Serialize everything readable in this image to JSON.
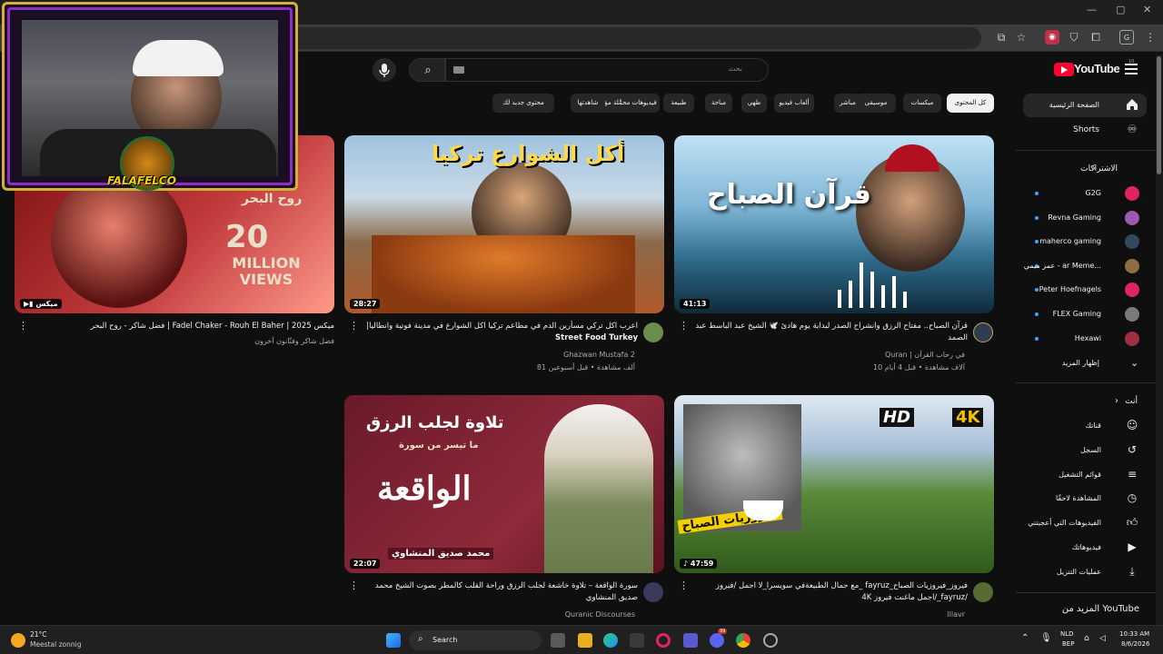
{
  "header": {
    "logo_text": "YouTube",
    "logo_sup": "10",
    "search_placeholder": "بحث"
  },
  "chips": [
    {
      "label": "كل المحتوى",
      "active": true
    },
    {
      "label": "ميكسات"
    },
    {
      "label": "موسيقى"
    },
    {
      "label": "مباشر"
    },
    {
      "label": "ألعاب فيديو"
    },
    {
      "label": "طهي"
    },
    {
      "label": "مباحة"
    },
    {
      "label": "طبيعة"
    },
    {
      "label": "فيديوهات محمَّلة مؤخرًا"
    },
    {
      "label": "شاهدتها"
    },
    {
      "label": "محتوى جديد لك"
    }
  ],
  "sidebar": {
    "home": "الصفحة الرئيسية",
    "shorts": "Shorts",
    "subs_heading": "الاشتراكات",
    "subscriptions": [
      {
        "name": "G2G",
        "color": "#e0245e"
      },
      {
        "name": "Revna Gaming",
        "color": "#9b59b6"
      },
      {
        "name": "maherco gaming",
        "color": "#34495e"
      },
      {
        "name": "عمر ميمي - ar Meme...",
        "color": "#8e6e3e"
      },
      {
        "name": "Peter Hoefnagels",
        "color": "#e0245e"
      },
      {
        "name": "FLEX Gaming",
        "color": "#7a7a7a"
      },
      {
        "name": "Hexawi",
        "color": "#a03040"
      }
    ],
    "show_more": "إظهار المزيد",
    "you_heading": "أنت",
    "you_items": [
      "قناتك",
      "السجل",
      "قوائم التشغيل",
      "المشاهدة لاحقًا",
      "الفيديوهات التي أعجبتني",
      "فيديوهاتك",
      "عمليات التنزيل"
    ],
    "more_from": "المزيد من YouTube"
  },
  "videos": [
    {
      "title": "ميكس Fadel Chaker - Rouh El Baher | 2025 | فضل شاكر - روح البحر",
      "channel": "فضل شاكر وفنّانون آخرون",
      "stats": "",
      "duration": "ميكس",
      "thumb_text": "20 MILLION VIEWS",
      "thumb_sub": "روح البحر",
      "avatar_color": ""
    },
    {
      "title": "اعرب اكل تركي مسأرين الدم في مطاعم تركيا  اكل الشوارع في مدينة فوتية وانطاليا|",
      "title_en": "Street Food Turkey",
      "channel": "Ghazwan Mustafa 2",
      "stats": "81 ألف مشاهدة • قبل أسبوعين",
      "duration": "28:27",
      "thumb_text": "أكل الشوارع تركيا",
      "avatar_color": "#6b8e4e"
    },
    {
      "title": "قرآن الصباح.. مفتاح الرزق وانشراح الصدر لبداية يوم هادئ 🕊️ الشيخ عبد الباسط عبد الصمد",
      "channel": "Quran | في رحاب القرآن",
      "stats": "10 آلاف مشاهدة • قبل 4 أيام",
      "duration": "41:13",
      "thumb_text": "قرآن الصباح",
      "avatar_color": "#2c3e50"
    },
    {
      "title": "سورة الواقعة – تلاوة خاشعة لجلب الرزق وراحة القلب كالمطر   بصوت الشيخ محمد صديق المنشاوي",
      "channel": "Quranic Discourses",
      "stats": "",
      "duration": "22:07",
      "thumb_text": "تلاوة لجلب الرزق",
      "thumb_sub": "ما تيسر من سورة",
      "thumb_big": "الواقعة",
      "thumb_name": "محمد صديق المنشاوي",
      "avatar_color": "#3a3a5a"
    },
    {
      "title": "فيروز_فيروزيات الصباح_fayruz _مع جمال الطبيعةفي سويسرا_لا اجمل /فيروز /fayruz_/اجمل ماغنت فيروز 4K",
      "channel": "lilavr",
      "stats": "",
      "duration": "47:59",
      "thumb_text": "فيروزيات الصباح",
      "thumb_badge": "HD",
      "thumb_badge2": "4K",
      "avatar_color": "#556b2f"
    }
  ],
  "overlay": {
    "brand": "FALAFELCO"
  },
  "taskbar": {
    "weather_temp": "21°C",
    "weather_desc": "Meestal zonnig",
    "search": "Search",
    "lang1": "NLD",
    "lang2": "BEP",
    "time": "10:33 AM",
    "date": "8/6/2026",
    "badge": "99"
  }
}
